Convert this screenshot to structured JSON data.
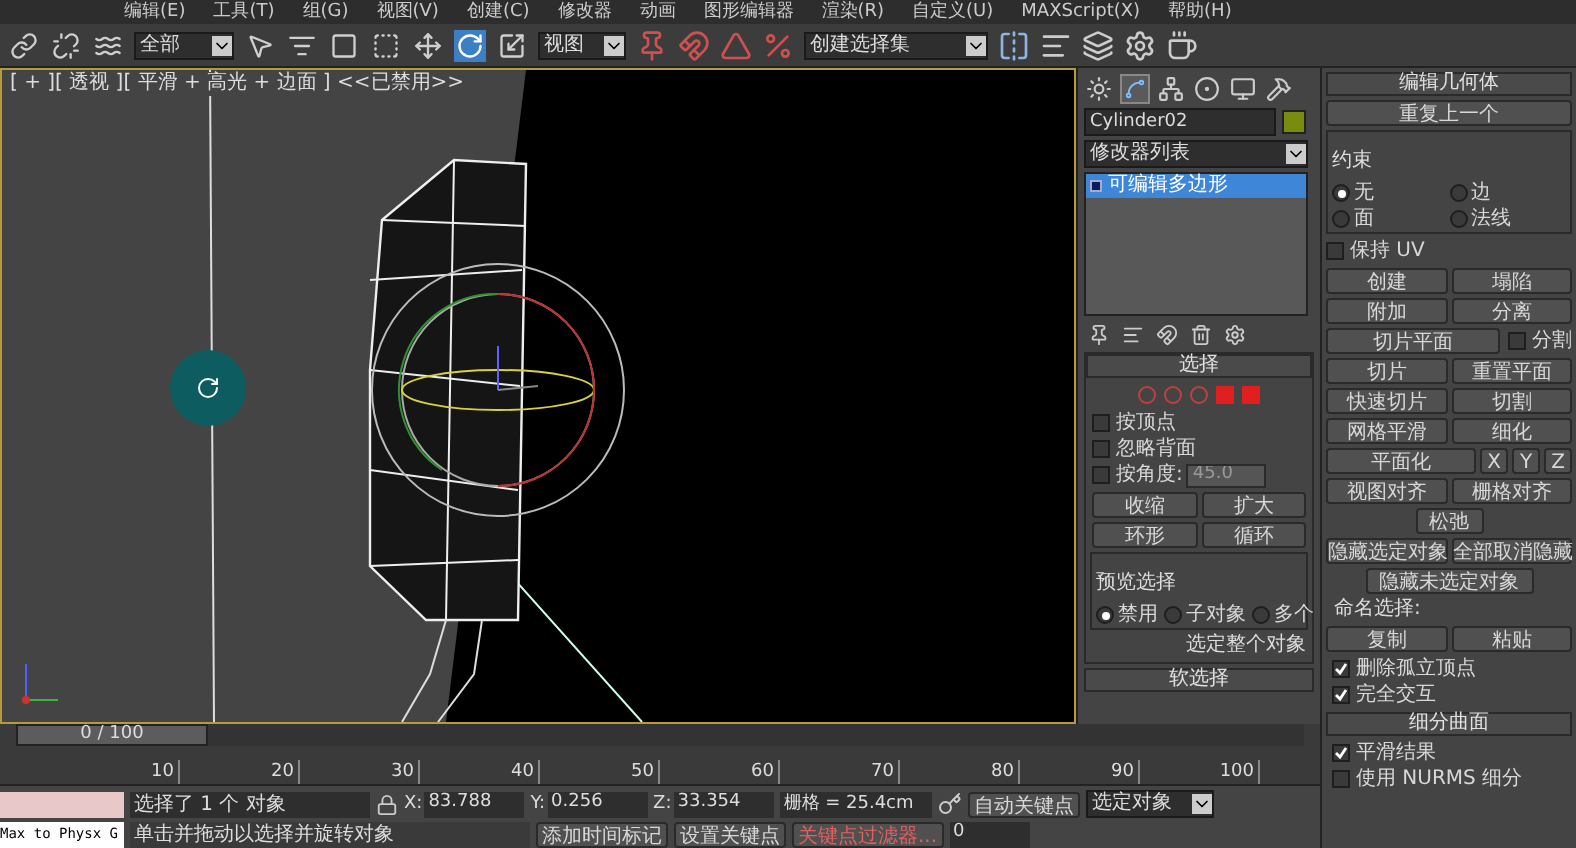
{
  "menu": [
    "编辑(E)",
    "工具(T)",
    "组(G)",
    "视图(V)",
    "创建(C)",
    "修改器",
    "动画",
    "图形编辑器",
    "渲染(R)",
    "自定义(U)",
    "MAXScript(X)",
    "帮助(H)"
  ],
  "toolbar": {
    "selection_filter": "全部",
    "reference_coord": "视图",
    "selection_set": "创建选择集",
    "tools": [
      {
        "selected": false
      },
      {
        "selected": false
      },
      {
        "selected": false
      },
      {
        "selected": false
      },
      {
        "selected": false
      },
      {
        "selected": false
      },
      {
        "selected": false
      },
      {
        "selected": false
      },
      {
        "selected": true
      },
      {
        "selected": false
      }
    ]
  },
  "viewport": {
    "label": "[ + ][ 透视 ][ 平滑 + 高光 + 边面 ] <<已禁用>>"
  },
  "command_panel": {
    "tabs": [
      {
        "selected": false
      },
      {
        "selected": true
      },
      {
        "selected": false
      },
      {
        "selected": false
      },
      {
        "selected": false
      },
      {
        "selected": false
      }
    ],
    "object_name": "Cylinder02",
    "modifier_list": "修改器列表",
    "stack": [
      {
        "label": "可编辑多边形",
        "selected": true
      }
    ],
    "selection": {
      "title": "选择",
      "checkboxes": [
        {
          "label": "按顶点",
          "checked": false
        },
        {
          "label": "忽略背面",
          "checked": false
        },
        {
          "label": "按角度:",
          "checked": false
        }
      ],
      "angle_value": "45.0",
      "buttons": [
        "收缩",
        "扩大"
      ],
      "spinner_buttons": [
        "环形",
        "循环"
      ],
      "preview": {
        "title": "预览选择",
        "options": [
          {
            "label": "禁用",
            "selected": true
          },
          {
            "label": "子对象",
            "selected": false
          },
          {
            "label": "多个",
            "selected": false
          }
        ]
      },
      "status": "选定整个对象"
    },
    "soft_selection": {
      "title": "软选择"
    }
  },
  "edit_geometry": {
    "title": "编辑几何体",
    "repeat_button": "重复上一个",
    "constraints": {
      "title": "约束",
      "options": [
        {
          "label": "无",
          "selected": true
        },
        {
          "label": "边",
          "selected": false
        },
        {
          "label": "面",
          "selected": false
        },
        {
          "label": "法线",
          "selected": false
        }
      ]
    },
    "preserve_uv": {
      "label": "保持 UV",
      "checked": false
    },
    "rows": [
      {
        "kind": "pair",
        "items": [
          "创建",
          "塌陷"
        ]
      },
      {
        "kind": "pair",
        "items": [
          "附加",
          "分离"
        ]
      },
      {
        "kind": "check",
        "items": [
          "切片平面"
        ],
        "check": {
          "label": "分割",
          "checked": false
        }
      },
      {
        "kind": "pair",
        "items": [
          "切片",
          "重置平面"
        ]
      },
      {
        "kind": "pair",
        "items": [
          "快速切片",
          "切割"
        ]
      },
      {
        "kind": "pair",
        "items": [
          "网格平滑",
          "细化"
        ]
      },
      {
        "kind": "axes",
        "items": [
          "平面化",
          "X",
          "Y",
          "Z"
        ]
      },
      {
        "kind": "pair",
        "items": [
          "视图对齐",
          "栅格对齐"
        ]
      },
      {
        "kind": "single",
        "items": [
          "松弛"
        ]
      },
      {
        "kind": "pair",
        "items": [
          "隐藏选定对象",
          "全部取消隐藏"
        ]
      },
      {
        "kind": "single",
        "items": [
          "隐藏未选定对象"
        ]
      }
    ],
    "named_selections": {
      "title": "命名选择:",
      "buttons": [
        "复制",
        "粘贴"
      ]
    },
    "checkboxes": [
      {
        "label": "删除孤立顶点",
        "checked": true
      },
      {
        "label": "完全交互",
        "checked": true
      }
    ]
  },
  "subdivision": {
    "title": "细分曲面",
    "checkboxes": [
      {
        "label": "平滑结果",
        "checked": true
      },
      {
        "label": "使用 NURMS 细分",
        "checked": false
      }
    ]
  },
  "timeline": {
    "frame": "0 / 100",
    "level": 0,
    "ticks": [
      "10",
      "20",
      "30",
      "40",
      "50",
      "60",
      "70",
      "80",
      "90",
      "100"
    ]
  },
  "status_bar": {
    "script_listener": "Max to Physx G",
    "selection": "选择了 1 个 对象",
    "coordinates": [
      {
        "axis": "X:",
        "value": "83.788"
      },
      {
        "axis": "Y:",
        "value": "0.256"
      },
      {
        "axis": "Z:",
        "value": "33.354"
      }
    ],
    "grid": "栅格 = 25.4cm",
    "prompt": "单击并拖动以选择并旋转对象",
    "add_time_tag": "添加时间标记",
    "auto_key": "自动关键点",
    "key_mode": "选定对象",
    "set_key": "设置关键点",
    "key_filters": "关键点过滤器...",
    "current_frame": "0"
  }
}
